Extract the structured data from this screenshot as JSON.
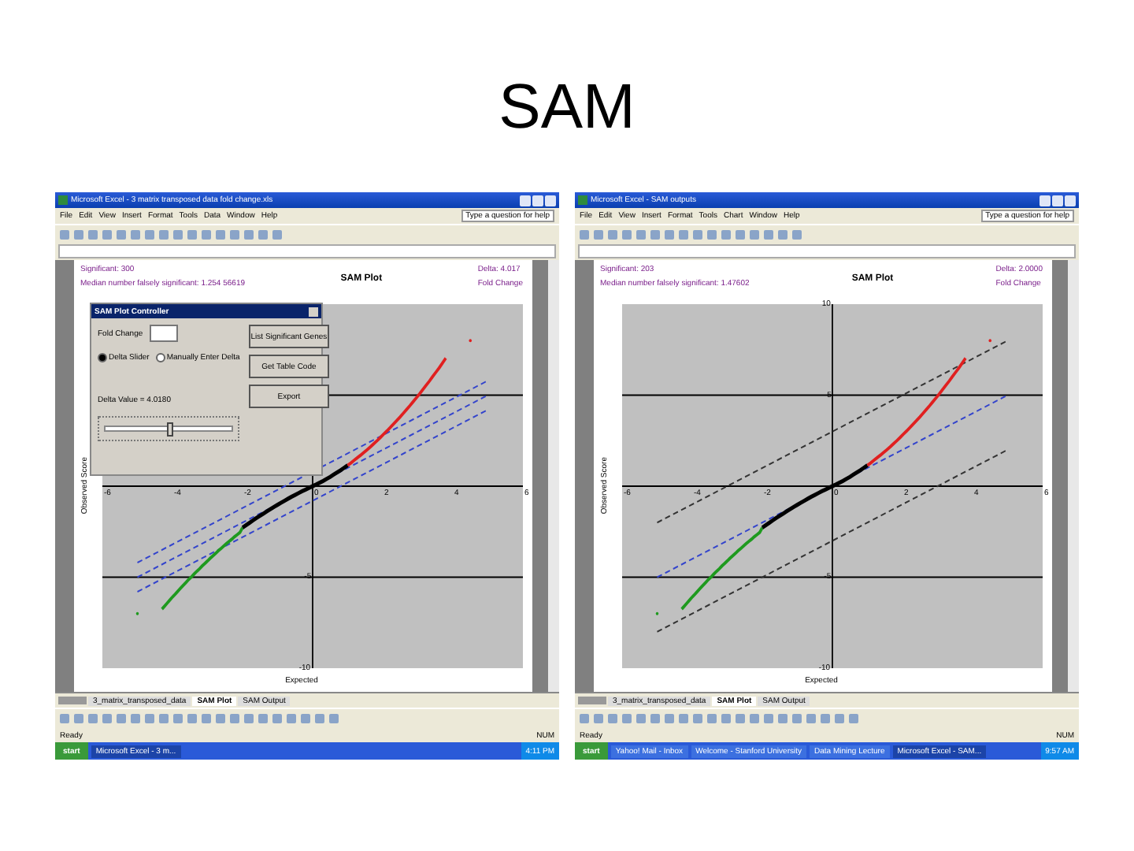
{
  "slide": {
    "title": "SAM"
  },
  "windows": [
    {
      "title": "Microsoft Excel - 3 matrix transposed data fold change.xls",
      "menu": [
        "File",
        "Edit",
        "View",
        "Insert",
        "Format",
        "Tools",
        "Data",
        "Window",
        "Help"
      ],
      "help_box": "Type a question for help",
      "header_left": [
        "Significant: 300",
        "Median number falsely significant: 1.254 56619"
      ],
      "header_right": [
        "Delta: 4.017",
        "Fold Change"
      ],
      "plot_title": "SAM Plot",
      "xlabel": "Expected",
      "ylabel": "Observed Score",
      "xticks": [
        "-6",
        "-4",
        "-2",
        "0",
        "2",
        "4",
        "6"
      ],
      "yticks": [
        "-5",
        "-10"
      ],
      "dialog": {
        "title": "SAM Plot Controller",
        "field_label": "Fold Change",
        "radios": [
          {
            "label": "Delta Slider",
            "selected": true
          },
          {
            "label": "Manually Enter Delta",
            "selected": false
          }
        ],
        "buttons": [
          "List Significant Genes",
          "Get Table Code",
          "Export"
        ],
        "delta_text": "Delta Value = 4.0180",
        "slider": {
          "level": 0.48
        }
      },
      "sheet_tabs": [
        {
          "label": "3_matrix_transposed_data",
          "selected": false
        },
        {
          "label": "SAM Plot",
          "selected": true
        },
        {
          "label": "SAM Output",
          "selected": false
        }
      ],
      "status": "Ready",
      "status_right": "NUM",
      "taskbar": {
        "start": "start",
        "items": [
          {
            "label": "Microsoft Excel - 3 m...",
            "selected": true
          }
        ],
        "clock": "4:11 PM"
      }
    },
    {
      "title": "Microsoft Excel - SAM outputs",
      "menu": [
        "File",
        "Edit",
        "View",
        "Insert",
        "Format",
        "Tools",
        "Chart",
        "Window",
        "Help"
      ],
      "help_box": "Type a question for help",
      "header_left": [
        "Significant: 203",
        "Median number falsely significant: 1.47602"
      ],
      "header_right": [
        "Delta: 2.0000",
        "Fold Change"
      ],
      "plot_title": "SAM Plot",
      "xlabel": "Expected",
      "ylabel": "Observed Score",
      "xticks": [
        "-6",
        "-4",
        "-2",
        "0",
        "2",
        "4",
        "6"
      ],
      "yticks": [
        "10",
        "5",
        "-5",
        "-10"
      ],
      "sheet_tabs": [
        {
          "label": "3_matrix_transposed_data",
          "selected": false
        },
        {
          "label": "SAM Plot",
          "selected": true
        },
        {
          "label": "SAM Output",
          "selected": false
        }
      ],
      "status": "Ready",
      "status_right": "NUM",
      "taskbar": {
        "start": "start",
        "items": [
          {
            "label": "Yahoo! Mail - Inbox",
            "selected": false
          },
          {
            "label": "Welcome - Stanford University",
            "selected": false
          },
          {
            "label": "Data Mining Lecture",
            "selected": false
          },
          {
            "label": "Microsoft Excel - SAM...",
            "selected": true
          }
        ],
        "clock": "9:57 AM"
      }
    }
  ]
}
